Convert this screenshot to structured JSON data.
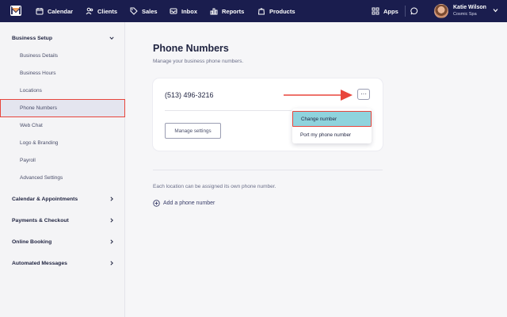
{
  "topnav": {
    "items": [
      {
        "label": "Calendar",
        "icon": "calendar-icon"
      },
      {
        "label": "Clients",
        "icon": "clients-icon"
      },
      {
        "label": "Sales",
        "icon": "tag-icon"
      },
      {
        "label": "Inbox",
        "icon": "inbox-icon"
      },
      {
        "label": "Reports",
        "icon": "bar-chart-icon"
      },
      {
        "label": "Products",
        "icon": "bag-icon"
      }
    ],
    "apps_label": "Apps",
    "user": {
      "name": "Katie Wilson",
      "org": "Cosmic Spa"
    }
  },
  "sidebar": {
    "business_setup": {
      "label": "Business Setup",
      "items": [
        {
          "label": "Business Details"
        },
        {
          "label": "Business Hours"
        },
        {
          "label": "Locations"
        },
        {
          "label": "Phone Numbers"
        },
        {
          "label": "Web Chat"
        },
        {
          "label": "Logo & Branding"
        },
        {
          "label": "Payroll"
        },
        {
          "label": "Advanced Settings"
        }
      ]
    },
    "sections": [
      {
        "label": "Calendar & Appointments"
      },
      {
        "label": "Payments & Checkout"
      },
      {
        "label": "Online Booking"
      },
      {
        "label": "Automated Messages"
      }
    ]
  },
  "main": {
    "title": "Phone Numbers",
    "subtitle": "Manage your business phone numbers.",
    "phone_number": "(513) 496-3216",
    "manage_button": "Manage settings",
    "more_button": "···",
    "menu": [
      {
        "label": "Change number"
      },
      {
        "label": "Port my phone number"
      }
    ],
    "info_text": "Each location can be assigned its own phone number.",
    "add_link": "Add a phone number"
  },
  "colors": {
    "nav_bg": "#1a1d4e",
    "highlight": "#e8453c",
    "menu_active": "#8fd3dd"
  }
}
